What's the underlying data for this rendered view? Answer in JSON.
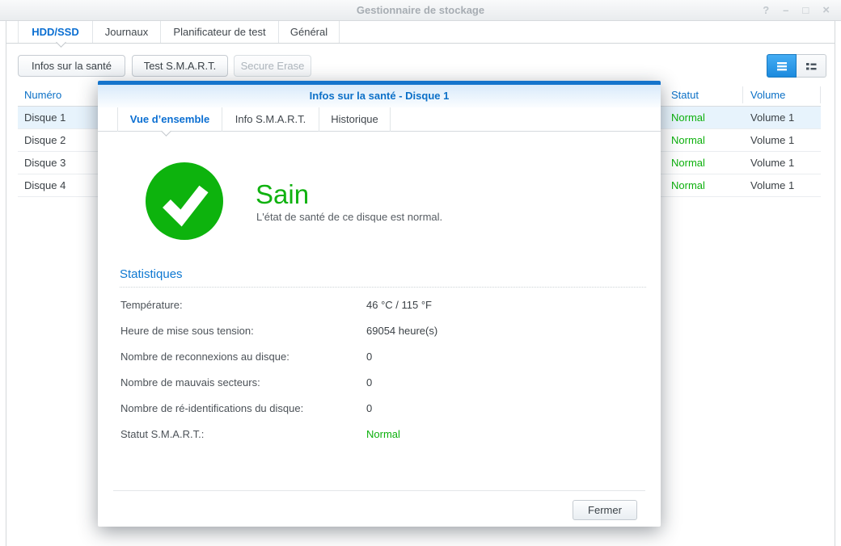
{
  "window": {
    "title": "Gestionnaire de stockage",
    "controls": [
      {
        "name": "help",
        "glyph": "?"
      },
      {
        "name": "minimize",
        "glyph": "–"
      },
      {
        "name": "maximize",
        "glyph": "□"
      },
      {
        "name": "close",
        "glyph": "×"
      }
    ]
  },
  "main_tabs": [
    {
      "label": "HDD/SSD",
      "active": true
    },
    {
      "label": "Journaux",
      "active": false
    },
    {
      "label": "Planificateur de test",
      "active": false
    },
    {
      "label": "Général",
      "active": false
    }
  ],
  "toolbar": {
    "buttons": [
      {
        "label": "Infos sur la santé",
        "enabled": true
      },
      {
        "label": "Test S.M.A.R.T.",
        "enabled": true
      },
      {
        "label": "Secure Erase",
        "enabled": false
      }
    ],
    "view_toggle": {
      "active": "list-view",
      "icons": [
        "list-icon",
        "detail-list-icon"
      ]
    }
  },
  "table": {
    "columns": [
      "Numéro",
      "Statut",
      "Volume"
    ],
    "rows": [
      {
        "numero": "Disque 1",
        "statut": "Normal",
        "volume": "Volume 1",
        "selected": true
      },
      {
        "numero": "Disque 2",
        "statut": "Normal",
        "volume": "Volume 1",
        "selected": false
      },
      {
        "numero": "Disque 3",
        "statut": "Normal",
        "volume": "Volume 1",
        "selected": false
      },
      {
        "numero": "Disque 4",
        "statut": "Normal",
        "volume": "Volume 1",
        "selected": false
      }
    ]
  },
  "dialog": {
    "title": "Infos sur la santé - Disque 1",
    "tabs": [
      {
        "label": "Vue d’ensemble",
        "active": true
      },
      {
        "label": "Info S.M.A.R.T.",
        "active": false
      },
      {
        "label": "Historique",
        "active": false
      }
    ],
    "health": {
      "status": "Sain",
      "description": "L'état de santé de ce disque est normal."
    },
    "statistics": {
      "title": "Statistiques",
      "rows": [
        {
          "label": "Température:",
          "value": "46 °C / 115 °F",
          "highlight": "none"
        },
        {
          "label": "Heure de mise sous tension:",
          "value": "69054 heure(s)",
          "highlight": "none"
        },
        {
          "label": "Nombre de reconnexions au disque:",
          "value": "0",
          "highlight": "none"
        },
        {
          "label": "Nombre de mauvais secteurs:",
          "value": "0",
          "highlight": "none"
        },
        {
          "label": "Nombre de ré-identifications du disque:",
          "value": "0",
          "highlight": "none"
        },
        {
          "label": "Statut S.M.A.R.T.:",
          "value": "Normal",
          "highlight": "green"
        }
      ]
    },
    "close_label": "Fermer"
  },
  "colors": {
    "accent_blue": "#0c70c8",
    "active_tab_blue": "#0b6fd2",
    "dialog_top_bar_blue": "#1474cc",
    "health_green": "#0db30d",
    "status_text_green": "#0cb00c",
    "selected_row_bg": "#e7f3fc",
    "toggle_active_blue": "#1b8ade"
  }
}
